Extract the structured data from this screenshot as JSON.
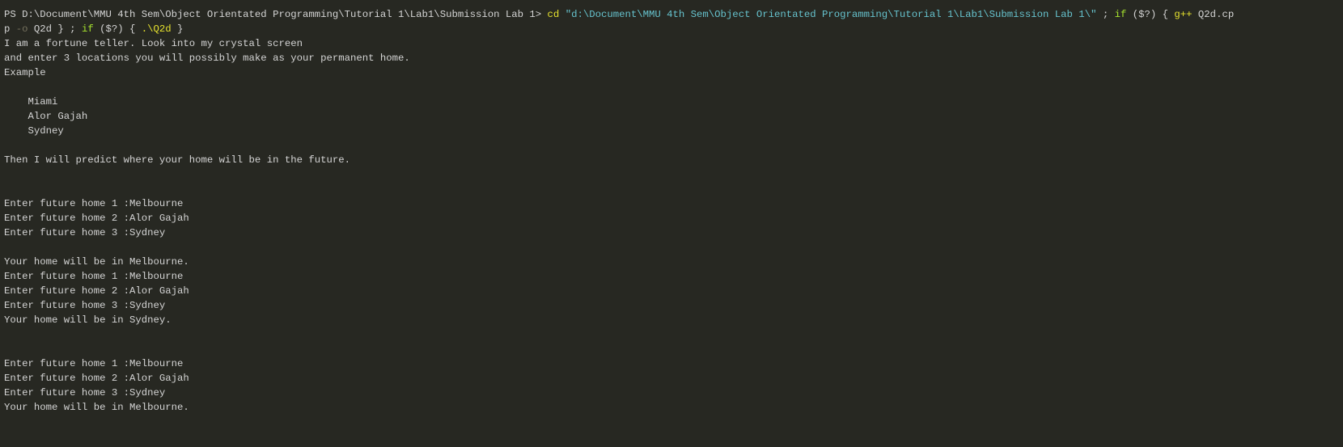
{
  "colors": {
    "background": "#272822",
    "text": "#d4d4d4",
    "command": "#e6e22e",
    "string": "#66c2cd",
    "keyword": "#a6e22e",
    "parameter": "#75715e"
  },
  "terminal": {
    "lines": [
      [
        {
          "t": "PS D:\\Document\\MMU 4th Sem\\Object Orientated Programming\\Tutorial 1\\Lab1\\Submission Lab 1> ",
          "c": "default"
        },
        {
          "t": "cd",
          "c": "cmd"
        },
        {
          "t": " ",
          "c": "default"
        },
        {
          "t": "\"d:\\Document\\MMU 4th Sem\\Object Orientated Programming\\Tutorial 1\\Lab1\\Submission Lab 1\\\"",
          "c": "string"
        },
        {
          "t": " ; ",
          "c": "default"
        },
        {
          "t": "if",
          "c": "keyword"
        },
        {
          "t": " ($?) { ",
          "c": "default"
        },
        {
          "t": "g++",
          "c": "cmd"
        },
        {
          "t": " Q2d.cp",
          "c": "default"
        }
      ],
      [
        {
          "t": "p ",
          "c": "default"
        },
        {
          "t": "-o",
          "c": "param"
        },
        {
          "t": " Q2d } ; ",
          "c": "default"
        },
        {
          "t": "if",
          "c": "keyword"
        },
        {
          "t": " ($?) { ",
          "c": "default"
        },
        {
          "t": ".\\Q2d",
          "c": "cmd"
        },
        {
          "t": " }",
          "c": "default"
        }
      ],
      [
        {
          "t": "I am a fortune teller. Look into my crystal screen",
          "c": "default"
        }
      ],
      [
        {
          "t": "and enter 3 locations you will possibly make as your permanent home.",
          "c": "default"
        }
      ],
      [
        {
          "t": "Example",
          "c": "default"
        }
      ],
      [],
      [
        {
          "t": "    Miami",
          "c": "default"
        }
      ],
      [
        {
          "t": "    Alor Gajah",
          "c": "default"
        }
      ],
      [
        {
          "t": "    Sydney",
          "c": "default"
        }
      ],
      [],
      [
        {
          "t": "Then I will predict where your home will be in the future.",
          "c": "default"
        }
      ],
      [],
      [],
      [
        {
          "t": "Enter future home 1 :Melbourne",
          "c": "default"
        }
      ],
      [
        {
          "t": "Enter future home 2 :Alor Gajah",
          "c": "default"
        }
      ],
      [
        {
          "t": "Enter future home 3 :Sydney",
          "c": "default"
        }
      ],
      [],
      [
        {
          "t": "Your home will be in Melbourne.",
          "c": "default"
        }
      ],
      [
        {
          "t": "Enter future home 1 :Melbourne",
          "c": "default"
        }
      ],
      [
        {
          "t": "Enter future home 2 :Alor Gajah",
          "c": "default"
        }
      ],
      [
        {
          "t": "Enter future home 3 :Sydney",
          "c": "default"
        }
      ],
      [
        {
          "t": "Your home will be in Sydney.",
          "c": "default"
        }
      ],
      [],
      [],
      [
        {
          "t": "Enter future home 1 :Melbourne",
          "c": "default"
        }
      ],
      [
        {
          "t": "Enter future home 2 :Alor Gajah",
          "c": "default"
        }
      ],
      [
        {
          "t": "Enter future home 3 :Sydney",
          "c": "default"
        }
      ],
      [
        {
          "t": "Your home will be in Melbourne.",
          "c": "default"
        }
      ]
    ]
  }
}
